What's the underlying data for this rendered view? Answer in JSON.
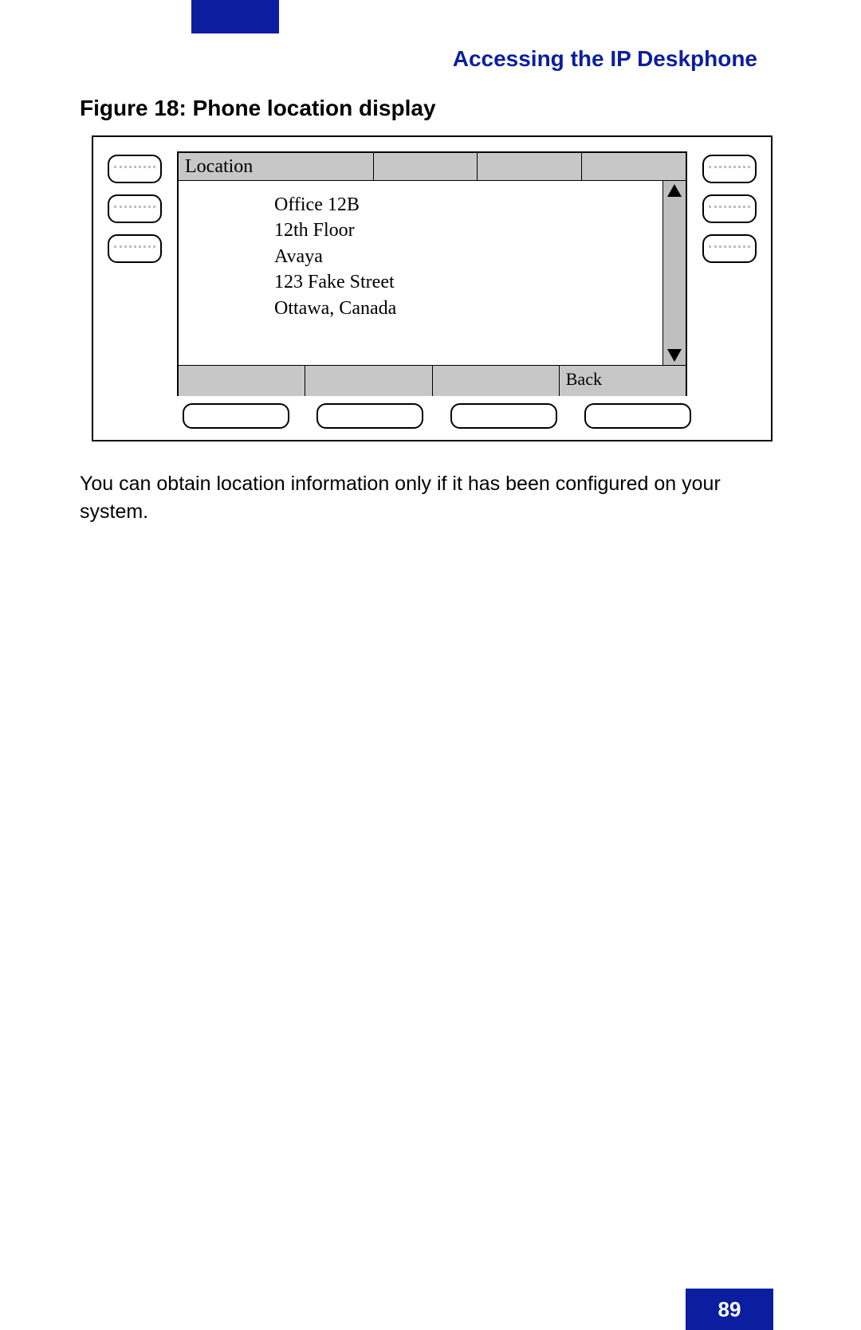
{
  "header": {
    "section_title": "Accessing the IP Deskphone"
  },
  "figure": {
    "caption": "Figure 18: Phone location display",
    "lcd": {
      "title_cells": [
        "Location",
        "",
        "",
        ""
      ],
      "location_lines": [
        "Office 12B",
        "12th Floor",
        "Avaya",
        "123 Fake Street",
        "Ottawa, Canada"
      ],
      "softkeys": [
        "",
        "",
        "",
        "Back"
      ]
    }
  },
  "body_text": "You can obtain location information only if it has been configured on your system.",
  "page_number": "89"
}
